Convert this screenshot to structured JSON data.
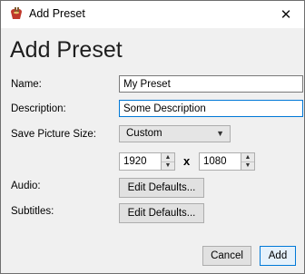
{
  "window": {
    "title": "Add Preset"
  },
  "heading": "Add Preset",
  "fields": {
    "name_label": "Name:",
    "name_value": "My Preset",
    "description_label": "Description:",
    "description_value": "Some Description",
    "picture_size_label": "Save Picture Size:",
    "picture_size_value": "Custom",
    "width_value": "1920",
    "times_symbol": "x",
    "height_value": "1080",
    "audio_label": "Audio:",
    "audio_button": "Edit Defaults...",
    "subtitles_label": "Subtitles:",
    "subtitles_button": "Edit Defaults..."
  },
  "footer": {
    "cancel_label": "Cancel",
    "add_label": "Add"
  },
  "icons": {
    "app": "handbrake-icon",
    "close": "close-icon"
  },
  "colors": {
    "focus_accent": "#0078d7",
    "dialog_bg": "#f0f0f0"
  }
}
